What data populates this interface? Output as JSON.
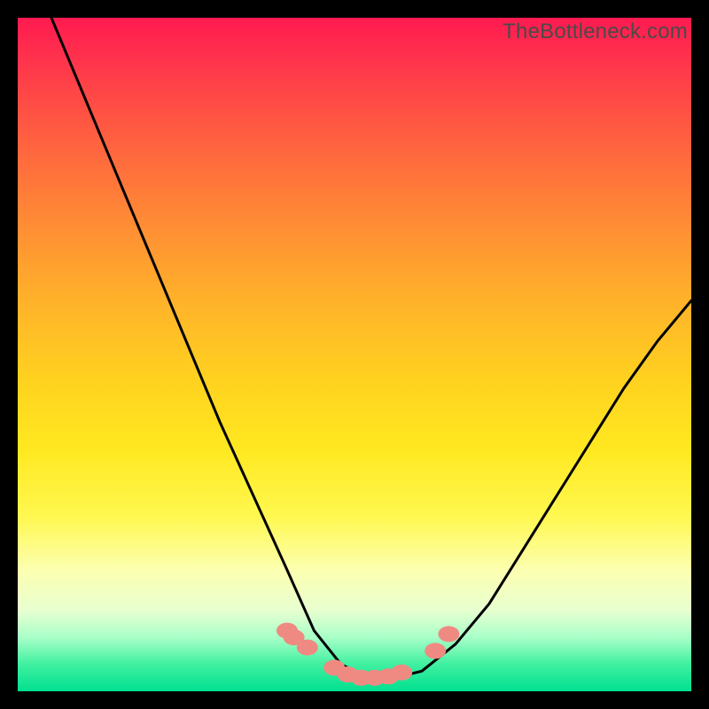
{
  "watermark": "TheBottleneck.com",
  "chart_data": {
    "type": "line",
    "title": "",
    "xlabel": "",
    "ylabel": "",
    "xlim": [
      0,
      100
    ],
    "ylim": [
      0,
      100
    ],
    "series": [
      {
        "name": "curve",
        "x": [
          5,
          10,
          15,
          20,
          25,
          30,
          35,
          40,
          44,
          48,
          52,
          56,
          60,
          65,
          70,
          75,
          80,
          85,
          90,
          95,
          100
        ],
        "values": [
          100,
          88,
          76,
          64,
          52,
          40,
          29,
          18,
          9,
          4,
          2,
          2,
          3,
          7,
          13,
          21,
          29,
          37,
          45,
          52,
          58
        ]
      }
    ],
    "markers": [
      {
        "x": 40.0,
        "y": 9.0
      },
      {
        "x": 41.0,
        "y": 8.0
      },
      {
        "x": 43.0,
        "y": 6.5
      },
      {
        "x": 47.0,
        "y": 3.5
      },
      {
        "x": 49.0,
        "y": 2.5
      },
      {
        "x": 51.0,
        "y": 2.0
      },
      {
        "x": 53.0,
        "y": 2.0
      },
      {
        "x": 55.0,
        "y": 2.2
      },
      {
        "x": 57.0,
        "y": 2.8
      },
      {
        "x": 62.0,
        "y": 6.0
      },
      {
        "x": 64.0,
        "y": 8.5
      }
    ],
    "background": {
      "gradient": "rainbow-vertical",
      "stops": [
        {
          "pos": 0.0,
          "color": "#ff1a50"
        },
        {
          "pos": 0.5,
          "color": "#ffd21f"
        },
        {
          "pos": 0.85,
          "color": "#fcffb0"
        },
        {
          "pos": 1.0,
          "color": "#00e090"
        }
      ]
    }
  }
}
